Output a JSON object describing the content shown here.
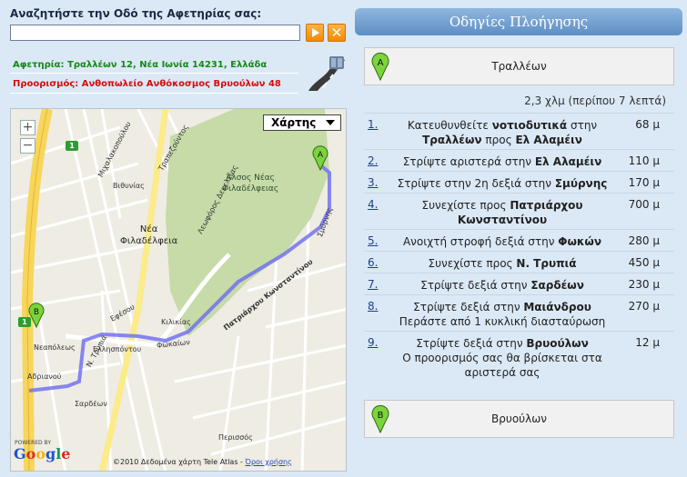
{
  "search": {
    "label": "Αναζητήστε την Οδό της Αφετηρίας σας:",
    "value": "",
    "placeholder": ""
  },
  "buttons": {
    "clear": "✕"
  },
  "route": {
    "origin": "Αφετηρία: Τραλλέων 12, Νέα Ιωνία 14231, Ελλάδα",
    "destination": "Προορισμός: Ανθοπωλείο Ανθόκοσμος Βρυούλων 48"
  },
  "map": {
    "type_selector": "Χάρτης",
    "zoom_in": "+",
    "zoom_out": "−",
    "copyright": "©2010 Δεδομένα χάρτη Tele Atlas - ",
    "terms": "Όροι χρήσης",
    "google": "Google",
    "powered": "POWERED BY",
    "city_label": "Νέα\nΦιλαδέλφεια",
    "park_label": "Άλσος Νέας\nΦιλαδέλφειας",
    "street_labels": {
      "leoforos_dekeleias": "Λεωφόρος Δεκελείας",
      "patriarchou": "Πατριάρχου Κωνσταντίνου",
      "smyrnis": "Σμύρνης",
      "fokaion": "Φωκαίων",
      "n_trypia": "Ν. Τρυπιά",
      "ellispontou": "Ελλησπόντου",
      "kilikias": "Κιλικίας",
      "efesou": "Εφέσου",
      "neapoleos": "Νεαπόλεως",
      "adrianou": "Αδριανού",
      "sardeon": "Σαρδέων",
      "michalakopoulou": "Μιχαλακοπούλου",
      "trapezountos": "Τραπεζούντος",
      "vithynias": "Βιθυνίας",
      "perissos": "Περισσός"
    },
    "marker_a": "A",
    "marker_b": "B",
    "shield_1": "1"
  },
  "directions": {
    "header": "Οδηγίες Πλοήγησης",
    "start": {
      "marker": "A",
      "name": "Τραλλέων"
    },
    "end": {
      "marker": "B",
      "name": "Βρυούλων"
    },
    "summary": "2,3 χλμ (περίπου 7 λεπτά)",
    "steps": [
      {
        "num": "1.",
        "pre": "Κατευθυνθείτε ",
        "b1": "νοτιοδυτικά",
        "mid": " στην ",
        "b2": "Τραλλέων",
        "mid2": " προς ",
        "b3": "Ελ Αλαμέιν",
        "post": "",
        "dist": "68 μ"
      },
      {
        "num": "2.",
        "pre": "Στρίψτε αριστερά στην ",
        "b1": "Ελ Αλαμέιν",
        "mid": "",
        "b2": "",
        "mid2": "",
        "b3": "",
        "post": "",
        "dist": "110 μ"
      },
      {
        "num": "3.",
        "pre": "Στρίψτε στην 2η δεξιά στην ",
        "b1": "Σμύρνης",
        "mid": "",
        "b2": "",
        "mid2": "",
        "b3": "",
        "post": "",
        "dist": "170 μ"
      },
      {
        "num": "4.",
        "pre": "Συνεχίστε προς ",
        "b1": "Πατριάρχου Κωνσταντίνου",
        "mid": "",
        "b2": "",
        "mid2": "",
        "b3": "",
        "post": "",
        "dist": "700 μ"
      },
      {
        "num": "5.",
        "pre": "Ανοιχτή στροφή δεξιά στην ",
        "b1": "Φωκών",
        "mid": "",
        "b2": "",
        "mid2": "",
        "b3": "",
        "post": "",
        "dist": "280 μ"
      },
      {
        "num": "6.",
        "pre": "Συνεχίστε προς ",
        "b1": "Ν. Τρυπιά",
        "mid": "",
        "b2": "",
        "mid2": "",
        "b3": "",
        "post": "",
        "dist": "450 μ"
      },
      {
        "num": "7.",
        "pre": "Στρίψτε δεξιά στην ",
        "b1": "Σαρδέων",
        "mid": "",
        "b2": "",
        "mid2": "",
        "b3": "",
        "post": "",
        "dist": "230 μ"
      },
      {
        "num": "8.",
        "pre": "Στρίψτε δεξιά στην ",
        "b1": "Μαιάνδρου",
        "mid": "",
        "b2": "",
        "mid2": "",
        "b3": "",
        "post": "Περάστε από 1 κυκλική διασταύρωση",
        "dist": "270 μ"
      },
      {
        "num": "9.",
        "pre": "Στρίψτε δεξιά στην ",
        "b1": "Βρυούλων",
        "mid": "",
        "b2": "",
        "mid2": "",
        "b3": "",
        "post": "Ο προορισμός σας θα βρίσκεται στα αριστερά σας",
        "dist": "12 μ"
      }
    ]
  }
}
